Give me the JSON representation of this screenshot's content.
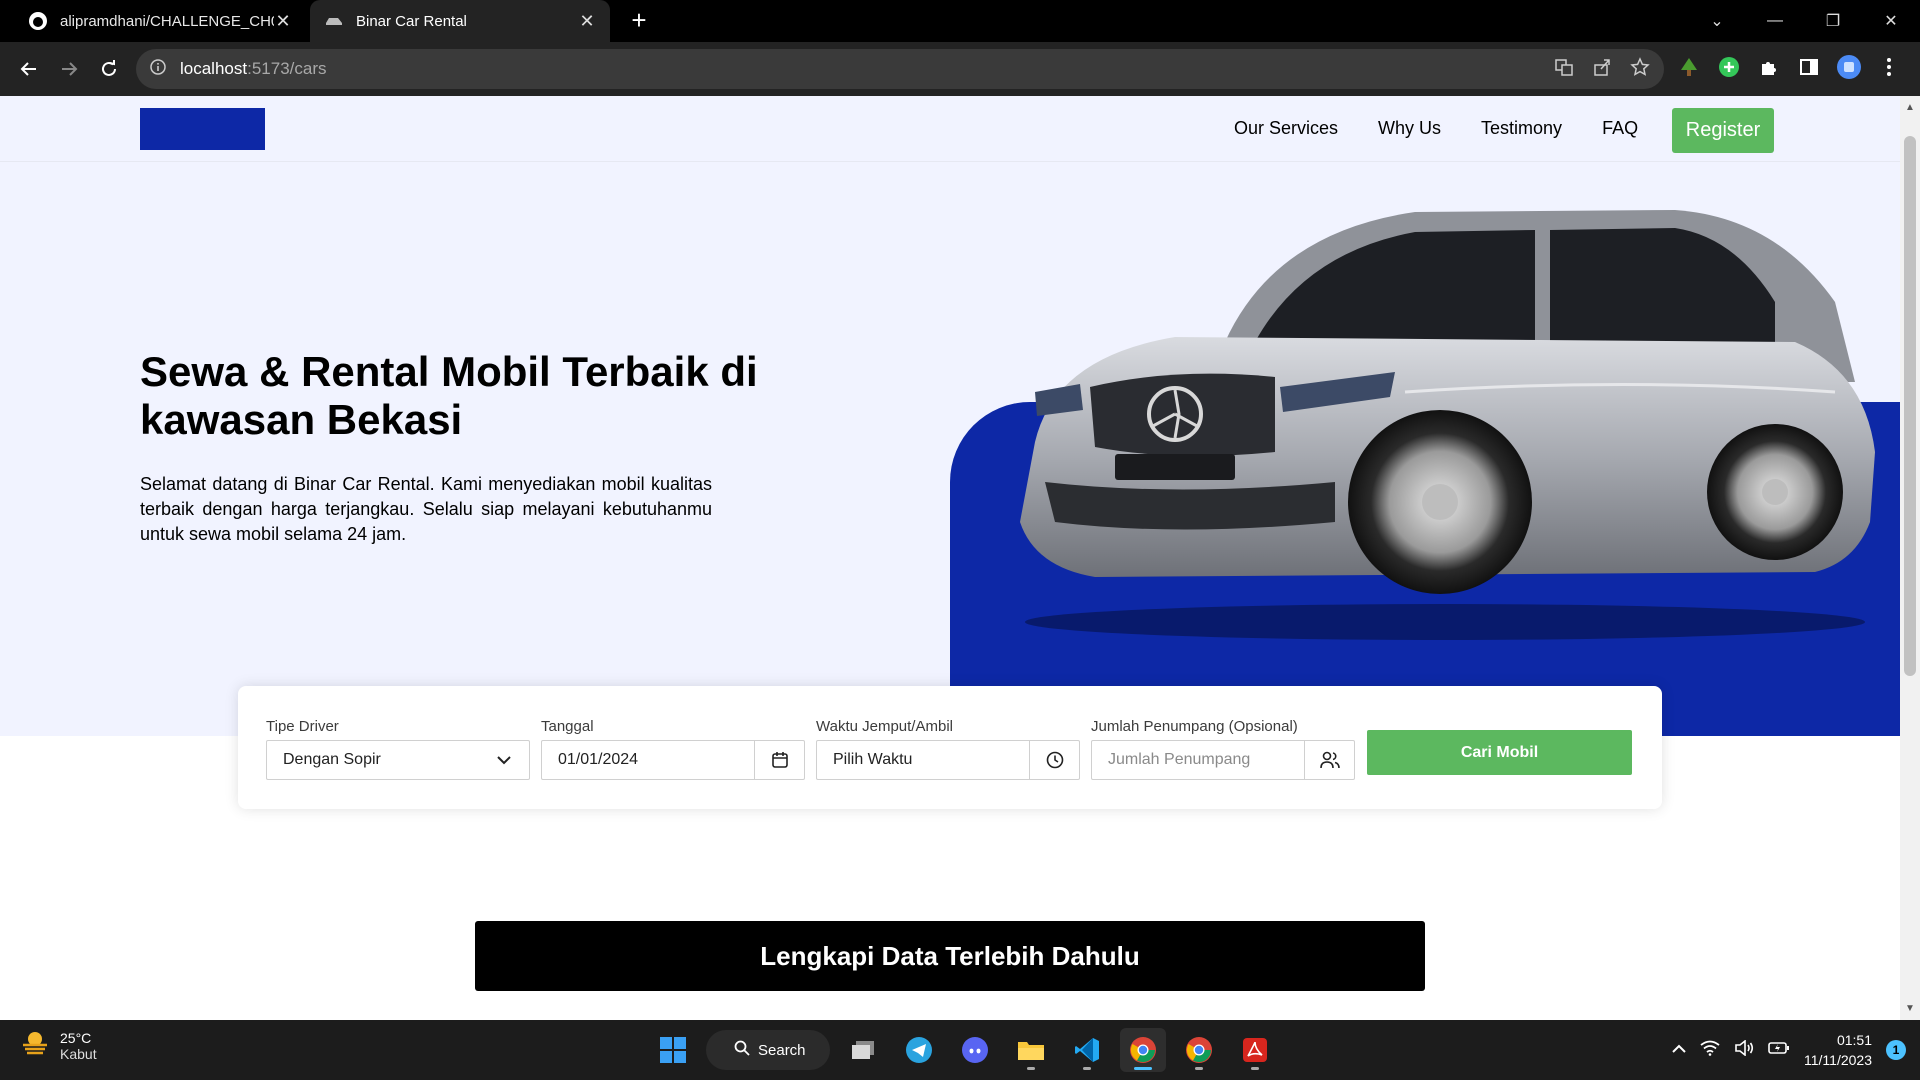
{
  "browser": {
    "tabs": [
      {
        "title": "alipramdhani/CHALLENGE_CH06",
        "active": false
      },
      {
        "title": "Binar Car Rental",
        "active": true
      }
    ],
    "url_host": "localhost",
    "url_path": ":5173/cars"
  },
  "site": {
    "nav": {
      "links": [
        "Our Services",
        "Why Us",
        "Testimony",
        "FAQ"
      ],
      "register_label": "Register"
    },
    "hero": {
      "title": "Sewa & Rental Mobil Terbaik di kawasan Bekasi",
      "description": "Selamat datang di Binar Car Rental. Kami menyediakan mobil kualitas terbaik dengan harga terjangkau. Selalu siap melayani kebutuhanmu untuk sewa mobil selama 24 jam."
    },
    "search": {
      "driver_label": "Tipe Driver",
      "driver_value": "Dengan Sopir",
      "date_label": "Tanggal",
      "date_value": "01/01/2024",
      "time_label": "Waktu Jemput/Ambil",
      "time_value": "Pilih Waktu",
      "passenger_label": "Jumlah Penumpang (Opsional)",
      "passenger_placeholder": "Jumlah Penumpang",
      "submit_label": "Cari Mobil"
    },
    "notice": "Lengkapi Data Terlebih Dahulu"
  },
  "taskbar": {
    "weather_temp": "25°C",
    "weather_cond": "Kabut",
    "search_label": "Search",
    "time": "01:51",
    "date": "11/11/2023",
    "notification_count": "1"
  },
  "colors": {
    "brand_blue": "#0d28a6",
    "accent_green": "#5cb85f",
    "hero_bg": "#f1f3ff"
  }
}
